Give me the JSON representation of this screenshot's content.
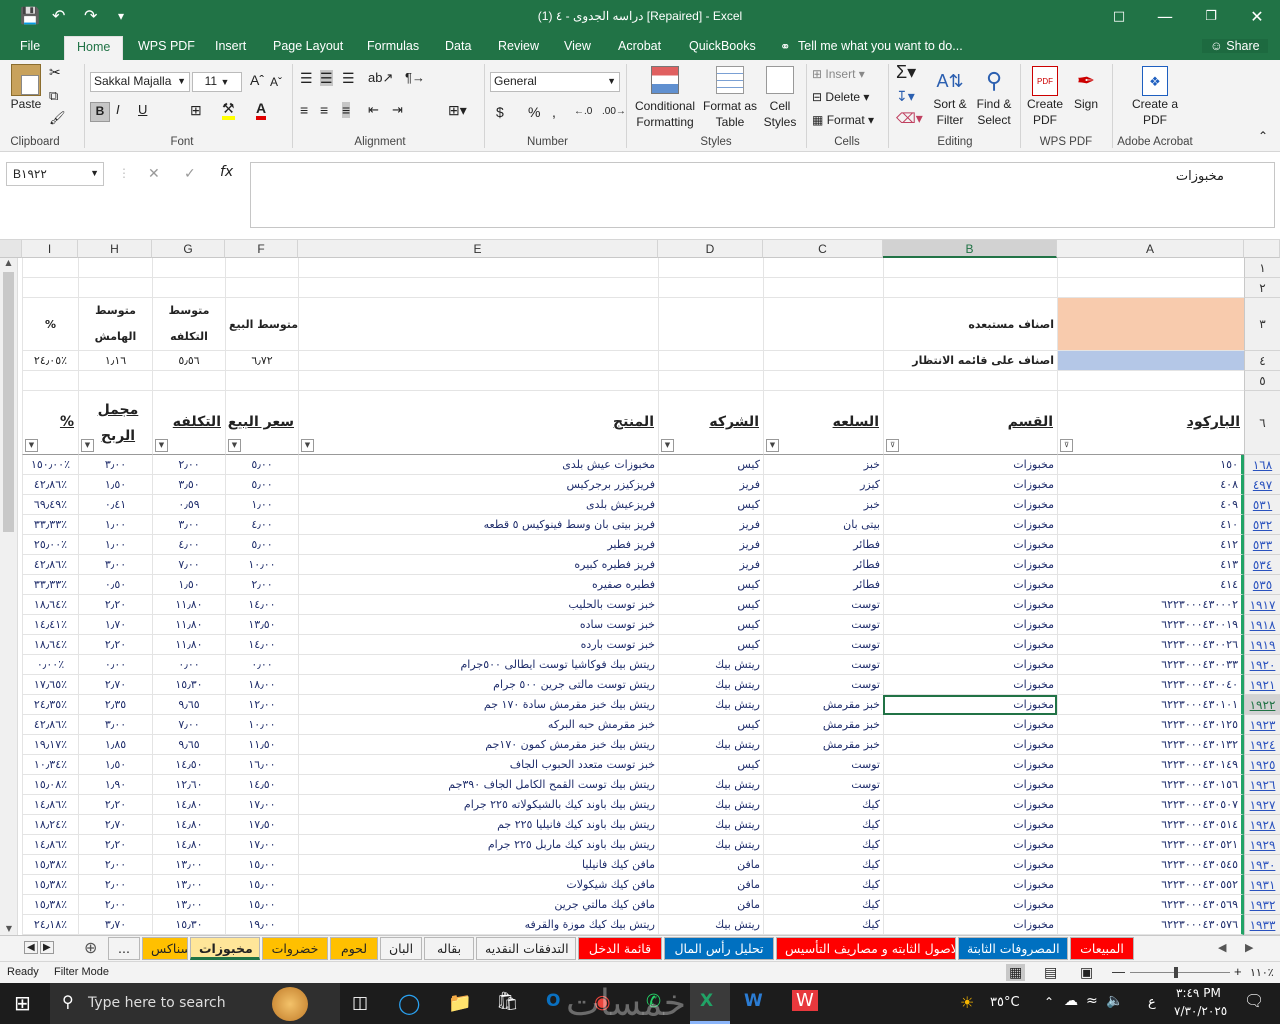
{
  "title": "دراسه الجدوى - ٤ (1) [Repaired] - Excel",
  "ribbon_tabs": [
    "File",
    "Home",
    "WPS PDF",
    "Insert",
    "Page Layout",
    "Formulas",
    "Data",
    "Review",
    "View",
    "Acrobat",
    "QuickBooks"
  ],
  "tell_me": "Tell me what you want to do...",
  "share": "Share",
  "clipboard": {
    "paste": "Paste",
    "label": "Clipboard"
  },
  "font": {
    "name": "Sakkal Majalla",
    "size": "11",
    "label": "Font"
  },
  "alignment": {
    "label": "Alignment"
  },
  "number": {
    "format": "General",
    "label": "Number"
  },
  "styles": {
    "conditional": "Conditional Formatting",
    "format_table": "Format as Table",
    "cell_styles": "Cell Styles",
    "label": "Styles"
  },
  "cells": {
    "insert": "Insert",
    "delete": "Delete",
    "format": "Format",
    "label": "Cells"
  },
  "editing": {
    "sort": "Sort & Filter",
    "find": "Find & Select",
    "label": "Editing"
  },
  "wps": {
    "create": "Create PDF",
    "sign": "Sign",
    "label": "WPS PDF"
  },
  "acrobat": {
    "create": "Create a PDF",
    "label": "Adobe Acrobat"
  },
  "namebox": "B١٩٢٢",
  "formula": "مخبوزات",
  "columns": [
    "A",
    "B",
    "C",
    "D",
    "E",
    "F",
    "G",
    "H",
    "I"
  ],
  "top_rows": {
    "r3_a": "اصناف مستبعده",
    "r4_a": "اصناف على قائمه الانتظار",
    "r3_f": "متوسط البيع",
    "r3_g": "متوسط التكلفه",
    "r3_h": "متوسط الهامش",
    "r3_i": "%",
    "r4_f": "٦٫٧٢",
    "r4_g": "٥٫٥٦",
    "r4_h": "١٫١٦",
    "r4_i": "٢٤٫٠٥٪"
  },
  "row_labels_top": [
    "١",
    "٢",
    "٣",
    "٤",
    "٥",
    "٦"
  ],
  "headers": {
    "a": "الباركود",
    "b": "القسم",
    "c": "السلعه",
    "d": "الشركه",
    "e": "المنتج",
    "f": "سعر البيع",
    "g": "التكلفه",
    "h": "مجمل الربح",
    "i": "%"
  },
  "rows": [
    {
      "n": "١٦٨",
      "a": "١٥٠",
      "b": "مخبوزات",
      "c": "خبز",
      "d": "كيس",
      "e": "مخبوزات عيش بلدى",
      "f": "٥٫٠٠",
      "g": "٢٫٠٠",
      "h": "٣٫٠٠",
      "i": "١٥٠٫٠٠٪"
    },
    {
      "n": "٤٩٧",
      "a": "٤٠٨",
      "b": "مخبوزات",
      "c": "كيزر",
      "d": "فريز",
      "e": "فريزكيزر برجركيس",
      "f": "٥٫٠٠",
      "g": "٣٫٥٠",
      "h": "١٫٥٠",
      "i": "٤٢٫٨٦٪"
    },
    {
      "n": "٥٣١",
      "a": "٤٠٩",
      "b": "مخبوزات",
      "c": "خبز",
      "d": "كيس",
      "e": "فريزعيش بلدى",
      "f": "١٫٠٠",
      "g": "٠٫٥٩",
      "h": "٠٫٤١",
      "i": "٦٩٫٤٩٪"
    },
    {
      "n": "٥٣٢",
      "a": "٤١٠",
      "b": "مخبوزات",
      "c": "بيتى بان",
      "d": "فريز",
      "e": "فريز بيتى بان وسط فينوكيس ٥ قطعه",
      "f": "٤٫٠٠",
      "g": "٣٫٠٠",
      "h": "١٫٠٠",
      "i": "٣٣٫٣٣٪"
    },
    {
      "n": "٥٣٣",
      "a": "٤١٢",
      "b": "مخبوزات",
      "c": "فطائر",
      "d": "فريز",
      "e": "فريز فطير",
      "f": "٥٫٠٠",
      "g": "٤٫٠٠",
      "h": "١٫٠٠",
      "i": "٢٥٫٠٠٪"
    },
    {
      "n": "٥٣٤",
      "a": "٤١٣",
      "b": "مخبوزات",
      "c": "فطائر",
      "d": "فريز",
      "e": "فريز فطيره كبيره",
      "f": "١٠٫٠٠",
      "g": "٧٫٠٠",
      "h": "٣٫٠٠",
      "i": "٤٢٫٨٦٪"
    },
    {
      "n": "٥٣٥",
      "a": "٤١٤",
      "b": "مخبوزات",
      "c": "فطائر",
      "d": "كيس",
      "e": "فطيره صفيره",
      "f": "٢٫٠٠",
      "g": "١٫٥٠",
      "h": "٠٫٥٠",
      "i": "٣٣٫٣٣٪"
    },
    {
      "n": "١٩١٧",
      "a": "٦٢٢٣٠٠٠٤٣٠٠٠٢",
      "b": "مخبوزات",
      "c": "توست",
      "d": "كيس",
      "e": "خبز توست بالحليب",
      "f": "١٤٫٠٠",
      "g": "١١٫٨٠",
      "h": "٢٫٢٠",
      "i": "١٨٫٦٤٪"
    },
    {
      "n": "١٩١٨",
      "a": "٦٢٢٣٠٠٠٤٣٠٠١٩",
      "b": "مخبوزات",
      "c": "توست",
      "d": "كيس",
      "e": "خبز توست ساده",
      "f": "١٣٫٥٠",
      "g": "١١٫٨٠",
      "h": "١٫٧٠",
      "i": "١٤٫٤١٪"
    },
    {
      "n": "١٩١٩",
      "a": "٦٢٢٣٠٠٠٤٣٠٠٢٦",
      "b": "مخبوزات",
      "c": "توست",
      "d": "كيس",
      "e": "خبز توست بارده",
      "f": "١٤٫٠٠",
      "g": "١١٫٨٠",
      "h": "٢٫٢٠",
      "i": "١٨٫٦٤٪"
    },
    {
      "n": "١٩٢٠",
      "a": "٦٢٢٣٠٠٠٤٣٠٠٣٣",
      "b": "مخبوزات",
      "c": "توست",
      "d": "ريتش بيك",
      "e": "ريتش بيك فوكاشيا توست ايطالى ٥٠٠جرام",
      "f": "٠٫٠٠",
      "g": "٠٫٠٠",
      "h": "٠٫٠٠",
      "i": "٠٫٠٠٪"
    },
    {
      "n": "١٩٢١",
      "a": "٦٢٢٣٠٠٠٤٣٠٠٤٠",
      "b": "مخبوزات",
      "c": "توست",
      "d": "ريتش بيك",
      "e": "ريتش توست مالتى جرين ٥٠٠ جرام",
      "f": "١٨٫٠٠",
      "g": "١٥٫٣٠",
      "h": "٢٫٧٠",
      "i": "١٧٫٦٥٪"
    },
    {
      "n": "١٩٢٢",
      "a": "٦٢٢٣٠٠٠٤٣٠١٠١",
      "b": "مخبوزات",
      "c": "خبز مقرمش",
      "d": "ريتش بيك",
      "e": "ريتش بيك خبز مقرمش سادة ١٧٠ جم",
      "f": "١٢٫٠٠",
      "g": "٩٫٦٥",
      "h": "٢٫٣٥",
      "i": "٢٤٫٣٥٪"
    },
    {
      "n": "١٩٢٣",
      "a": "٦٢٢٣٠٠٠٤٣٠١٢٥",
      "b": "مخبوزات",
      "c": "خبز مقرمش",
      "d": "كيس",
      "e": "خبز مقرمش حبه البركه",
      "f": "١٠٫٠٠",
      "g": "٧٫٠٠",
      "h": "٣٫٠٠",
      "i": "٤٢٫٨٦٪"
    },
    {
      "n": "١٩٢٤",
      "a": "٦٢٢٣٠٠٠٤٣٠١٣٢",
      "b": "مخبوزات",
      "c": "خبز مقرمش",
      "d": "ريتش بيك",
      "e": "ريتش بيك خبز مقرمش كمون ١٧٠جم",
      "f": "١١٫٥٠",
      "g": "٩٫٦٥",
      "h": "١٫٨٥",
      "i": "١٩٫١٧٪"
    },
    {
      "n": "١٩٢٥",
      "a": "٦٢٢٣٠٠٠٤٣٠١٤٩",
      "b": "مخبوزات",
      "c": "توست",
      "d": "كيس",
      "e": "خبز توست متعدد الحبوب الجاف",
      "f": "١٦٫٠٠",
      "g": "١٤٫٥٠",
      "h": "١٫٥٠",
      "i": "١٠٫٣٤٪"
    },
    {
      "n": "١٩٢٦",
      "a": "٦٢٢٣٠٠٠٤٣٠١٥٦",
      "b": "مخبوزات",
      "c": "توست",
      "d": "ريتش بيك",
      "e": "ريتش بيك توست القمح الكامل الجاف ٣٩٠جم",
      "f": "١٤٫٥٠",
      "g": "١٢٫٦٠",
      "h": "١٫٩٠",
      "i": "١٥٫٠٨٪"
    },
    {
      "n": "١٩٢٧",
      "a": "٦٢٢٣٠٠٠٤٣٠٥٠٧",
      "b": "مخبوزات",
      "c": "كيك",
      "d": "ريتش بيك",
      "e": "ريتش بيك باوند كيك بالشيكولاته ٢٢٥ جرام",
      "f": "١٧٫٠٠",
      "g": "١٤٫٨٠",
      "h": "٢٫٢٠",
      "i": "١٤٫٨٦٪"
    },
    {
      "n": "١٩٢٨",
      "a": "٦٢٢٣٠٠٠٤٣٠٥١٤",
      "b": "مخبوزات",
      "c": "كيك",
      "d": "ريتش بيك",
      "e": "ريتش بيك باوند كيك فانيليا ٢٢٥ جم",
      "f": "١٧٫٥٠",
      "g": "١٤٫٨٠",
      "h": "٢٫٧٠",
      "i": "١٨٫٢٤٪"
    },
    {
      "n": "١٩٢٩",
      "a": "٦٢٢٣٠٠٠٤٣٠٥٢١",
      "b": "مخبوزات",
      "c": "كيك",
      "d": "ريتش بيك",
      "e": "ريتش بيك باوند كيك ماربل ٢٢٥ جرام",
      "f": "١٧٫٠٠",
      "g": "١٤٫٨٠",
      "h": "٢٫٢٠",
      "i": "١٤٫٨٦٪"
    },
    {
      "n": "١٩٣٠",
      "a": "٦٢٢٣٠٠٠٤٣٠٥٤٥",
      "b": "مخبوزات",
      "c": "كيك",
      "d": "مافن",
      "e": "مافن كيك فانيليا",
      "f": "١٥٫٠٠",
      "g": "١٣٫٠٠",
      "h": "٢٫٠٠",
      "i": "١٥٫٣٨٪"
    },
    {
      "n": "١٩٣١",
      "a": "٦٢٢٣٠٠٠٤٣٠٥٥٢",
      "b": "مخبوزات",
      "c": "كيك",
      "d": "مافن",
      "e": "مافن كيك شيكولات",
      "f": "١٥٫٠٠",
      "g": "١٣٫٠٠",
      "h": "٢٫٠٠",
      "i": "١٥٫٣٨٪"
    },
    {
      "n": "١٩٣٢",
      "a": "٦٢٢٣٠٠٠٤٣٠٥٦٩",
      "b": "مخبوزات",
      "c": "كيك",
      "d": "مافن",
      "e": "مافن كيك مالتي جرين",
      "f": "١٥٫٠٠",
      "g": "١٣٫٠٠",
      "h": "٢٫٠٠",
      "i": "١٥٫٣٨٪"
    },
    {
      "n": "١٩٣٣",
      "a": "٦٢٢٣٠٠٠٤٣٠٥٧٦",
      "b": "مخبوزات",
      "c": "كيك",
      "d": "ريتش بيك",
      "e": "ريتش بيك كيك موزة والقرفه",
      "f": "١٩٫٠٠",
      "g": "١٥٫٣٠",
      "h": "٣٫٧٠",
      "i": "٢٤٫١٨٪"
    }
  ],
  "sheet_tabs": [
    {
      "label": "...",
      "color": "#f3f3f3",
      "fg": "#222"
    },
    {
      "label": "سناكس",
      "color": "#ffc000",
      "fg": "#222"
    },
    {
      "label": "مخبوزات",
      "color": "#ffe699",
      "fg": "#222",
      "active": true
    },
    {
      "label": "خضروات",
      "color": "#ffc000",
      "fg": "#222"
    },
    {
      "label": "لحوم",
      "color": "#ffc000",
      "fg": "#222"
    },
    {
      "label": "البان",
      "color": "#f3f3f3",
      "fg": "#222"
    },
    {
      "label": "بقاله",
      "color": "#f3f3f3",
      "fg": "#222"
    },
    {
      "label": "التدفقات النقديه",
      "color": "#f3f3f3",
      "fg": "#222"
    },
    {
      "label": "قائمة الدخل",
      "color": "#ff0000",
      "fg": "#fff"
    },
    {
      "label": "تحليل رأس المال",
      "color": "#0070c0",
      "fg": "#fff"
    },
    {
      "label": "الاصول الثابته و مصاريف التأسيس",
      "color": "#ff0000",
      "fg": "#fff"
    },
    {
      "label": "المصروفات الثابتة",
      "color": "#0070c0",
      "fg": "#fff"
    },
    {
      "label": "المبيعات",
      "color": "#ff0000",
      "fg": "#fff"
    }
  ],
  "status": {
    "ready": "Ready",
    "mode": "Filter Mode",
    "zoom": "١١٠٪"
  },
  "taskbar": {
    "search": "Type here to search",
    "temp": "٣٥°C",
    "time": "٣:٤٩ PM",
    "date": "٧/٣٠/٢٠٢٥",
    "lang": "ع",
    "watermark": "خمسات"
  }
}
